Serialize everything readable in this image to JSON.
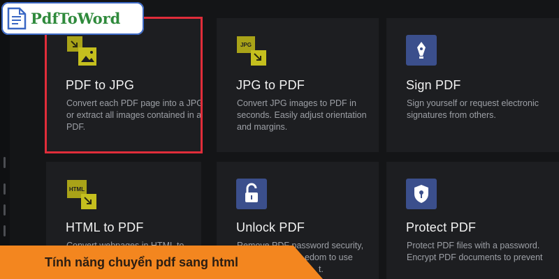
{
  "logo": {
    "text": "PdfToWord"
  },
  "tools": [
    {
      "title": "PDF to JPG",
      "description": "Convert each PDF page into a JPG or extract all images contained in a PDF.",
      "icon": "pdf-to-jpg-icon"
    },
    {
      "title": "JPG to PDF",
      "description": "Convert JPG images to PDF in seconds. Easily adjust orientation and margins.",
      "icon": "jpg-to-pdf-icon",
      "icon_label": "JPG"
    },
    {
      "title": "Sign PDF",
      "description": "Sign yourself or request electronic signatures from others.",
      "icon": "pen-nib-icon"
    },
    {
      "title": "HTML to PDF",
      "description": "Convert webpages in HTML to",
      "icon": "html-to-pdf-icon",
      "icon_label": "HTML"
    },
    {
      "title": "Unlock PDF",
      "description": "Remove PDF password security,",
      "description_2": "edom to use",
      "description_3": "t.",
      "icon": "unlock-icon"
    },
    {
      "title": "Protect PDF",
      "description": "Protect PDF files with a password. Encrypt PDF documents to prevent",
      "icon": "shield-lock-icon"
    }
  ],
  "banner": {
    "text": "Tính năng chuyển pdf sang html"
  },
  "colors": {
    "highlight": "#e02d3a",
    "banner": "#f3861f",
    "olive_icon": "#a9a318",
    "blue_icon": "#3b4f8c"
  }
}
